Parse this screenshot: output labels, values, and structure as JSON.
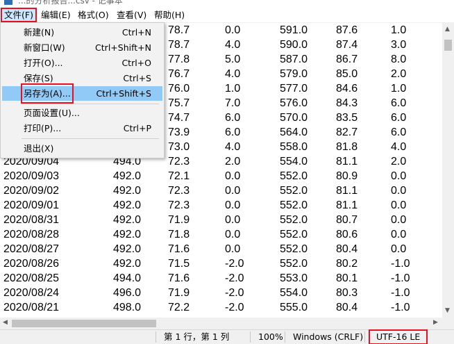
{
  "window": {
    "title": "...的分析报告...csv - 记事本"
  },
  "menubar": {
    "file": "文件(F)",
    "edit": "编辑(E)",
    "format": "格式(O)",
    "view": "查看(V)",
    "help": "帮助(H)"
  },
  "file_menu": {
    "new": {
      "label": "新建(N)",
      "shortcut": "Ctrl+N"
    },
    "new_window": {
      "label": "新窗口(W)",
      "shortcut": "Ctrl+Shift+N"
    },
    "open": {
      "label": "打开(O)...",
      "shortcut": "Ctrl+O"
    },
    "save": {
      "label": "保存(S)",
      "shortcut": "Ctrl+S"
    },
    "save_as": {
      "label": "另存为(A)...",
      "shortcut": "Ctrl+Shift+S"
    },
    "page_setup": {
      "label": "页面设置(U)...",
      "shortcut": ""
    },
    "print": {
      "label": "打印(P)...",
      "shortcut": "Ctrl+P"
    },
    "exit": {
      "label": "退出(X)",
      "shortcut": ""
    }
  },
  "editor": {
    "rows": [
      [
        "",
        "",
        "78.7",
        "0.0",
        "591.0",
        "87.6",
        "1.0"
      ],
      [
        "",
        "",
        "78.7",
        "4.0",
        "590.0",
        "87.4",
        "3.0"
      ],
      [
        "",
        "",
        "77.8",
        "5.0",
        "587.0",
        "86.7",
        "8.0"
      ],
      [
        "",
        "",
        "76.7",
        "4.0",
        "579.0",
        "85.0",
        "2.0"
      ],
      [
        "",
        "",
        "76.0",
        "1.0",
        "577.0",
        "84.6",
        "1.0"
      ],
      [
        "",
        "",
        "75.7",
        "7.0",
        "576.0",
        "84.3",
        "6.0"
      ],
      [
        "",
        "",
        "74.7",
        "6.0",
        "570.0",
        "83.5",
        "6.0"
      ],
      [
        "",
        "",
        "73.9",
        "6.0",
        "564.0",
        "82.7",
        "6.0"
      ],
      [
        "",
        "",
        "73.0",
        "4.0",
        "558.0",
        "81.8",
        "4.0"
      ],
      [
        "2020/09/04",
        "494.0",
        "72.3",
        "2.0",
        "554.0",
        "81.1",
        "2.0"
      ],
      [
        "2020/09/03",
        "492.0",
        "72.1",
        "0.0",
        "552.0",
        "80.9",
        "0.0"
      ],
      [
        "2020/09/02",
        "492.0",
        "72.3",
        "0.0",
        "552.0",
        "81.1",
        "0.0"
      ],
      [
        "2020/09/01",
        "492.0",
        "72.3",
        "0.0",
        "552.0",
        "81.1",
        "0.0"
      ],
      [
        "2020/08/31",
        "492.0",
        "71.9",
        "0.0",
        "552.0",
        "80.7",
        "0.0"
      ],
      [
        "2020/08/28",
        "492.0",
        "71.8",
        "0.0",
        "552.0",
        "80.6",
        "0.0"
      ],
      [
        "2020/08/27",
        "492.0",
        "71.6",
        "0.0",
        "552.0",
        "80.4",
        "0.0"
      ],
      [
        "2020/08/26",
        "492.0",
        "71.5",
        "-2.0",
        "552.0",
        "80.2",
        "-1.0"
      ],
      [
        "2020/08/25",
        "494.0",
        "71.6",
        "-2.0",
        "553.0",
        "80.1",
        "-1.0"
      ],
      [
        "2020/08/24",
        "496.0",
        "71.9",
        "-2.0",
        "554.0",
        "80.3",
        "-1.0"
      ],
      [
        "2020/08/21",
        "498.0",
        "72.2",
        "-2.0",
        "555.0",
        "80.4",
        "-1.0"
      ]
    ]
  },
  "statusbar": {
    "position": "第 1 行，第 1 列",
    "zoom": "100%",
    "line_ending": "Windows (CRLF)",
    "encoding": "UTF-16 LE"
  }
}
